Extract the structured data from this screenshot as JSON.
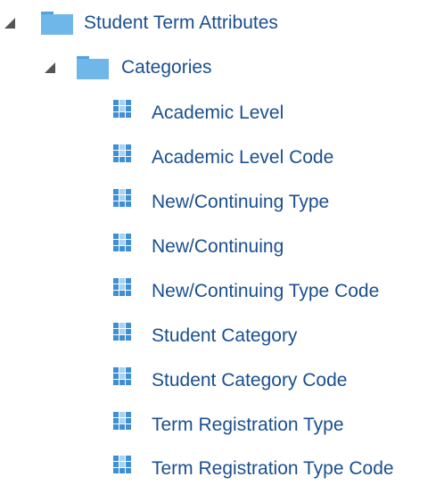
{
  "tree": {
    "root": {
      "label": "Student Term Attributes",
      "icon": "folder-icon",
      "expanded": true
    },
    "folder": {
      "label": "Categories",
      "icon": "folder-icon",
      "expanded": true
    },
    "items": [
      {
        "label": "Academic Level",
        "icon": "grid-attribute-icon"
      },
      {
        "label": "Academic Level Code",
        "icon": "grid-attribute-icon"
      },
      {
        "label": "New/Continuing Type",
        "icon": "grid-attribute-icon"
      },
      {
        "label": "New/Continuing",
        "icon": "grid-attribute-icon"
      },
      {
        "label": "New/Continuing Type Code",
        "icon": "grid-attribute-icon"
      },
      {
        "label": "Student Category",
        "icon": "grid-attribute-icon"
      },
      {
        "label": "Student Category Code",
        "icon": "grid-attribute-icon"
      },
      {
        "label": "Term Registration Type",
        "icon": "grid-attribute-icon"
      },
      {
        "label": "Term Registration Type Code",
        "icon": "grid-attribute-icon"
      }
    ]
  },
  "colors": {
    "label": "#1a4f8f",
    "folder": "#6fb7e8",
    "folder_tab": "#4fa3e0",
    "grid": "#3f8fd4",
    "twisty": "#555555"
  }
}
